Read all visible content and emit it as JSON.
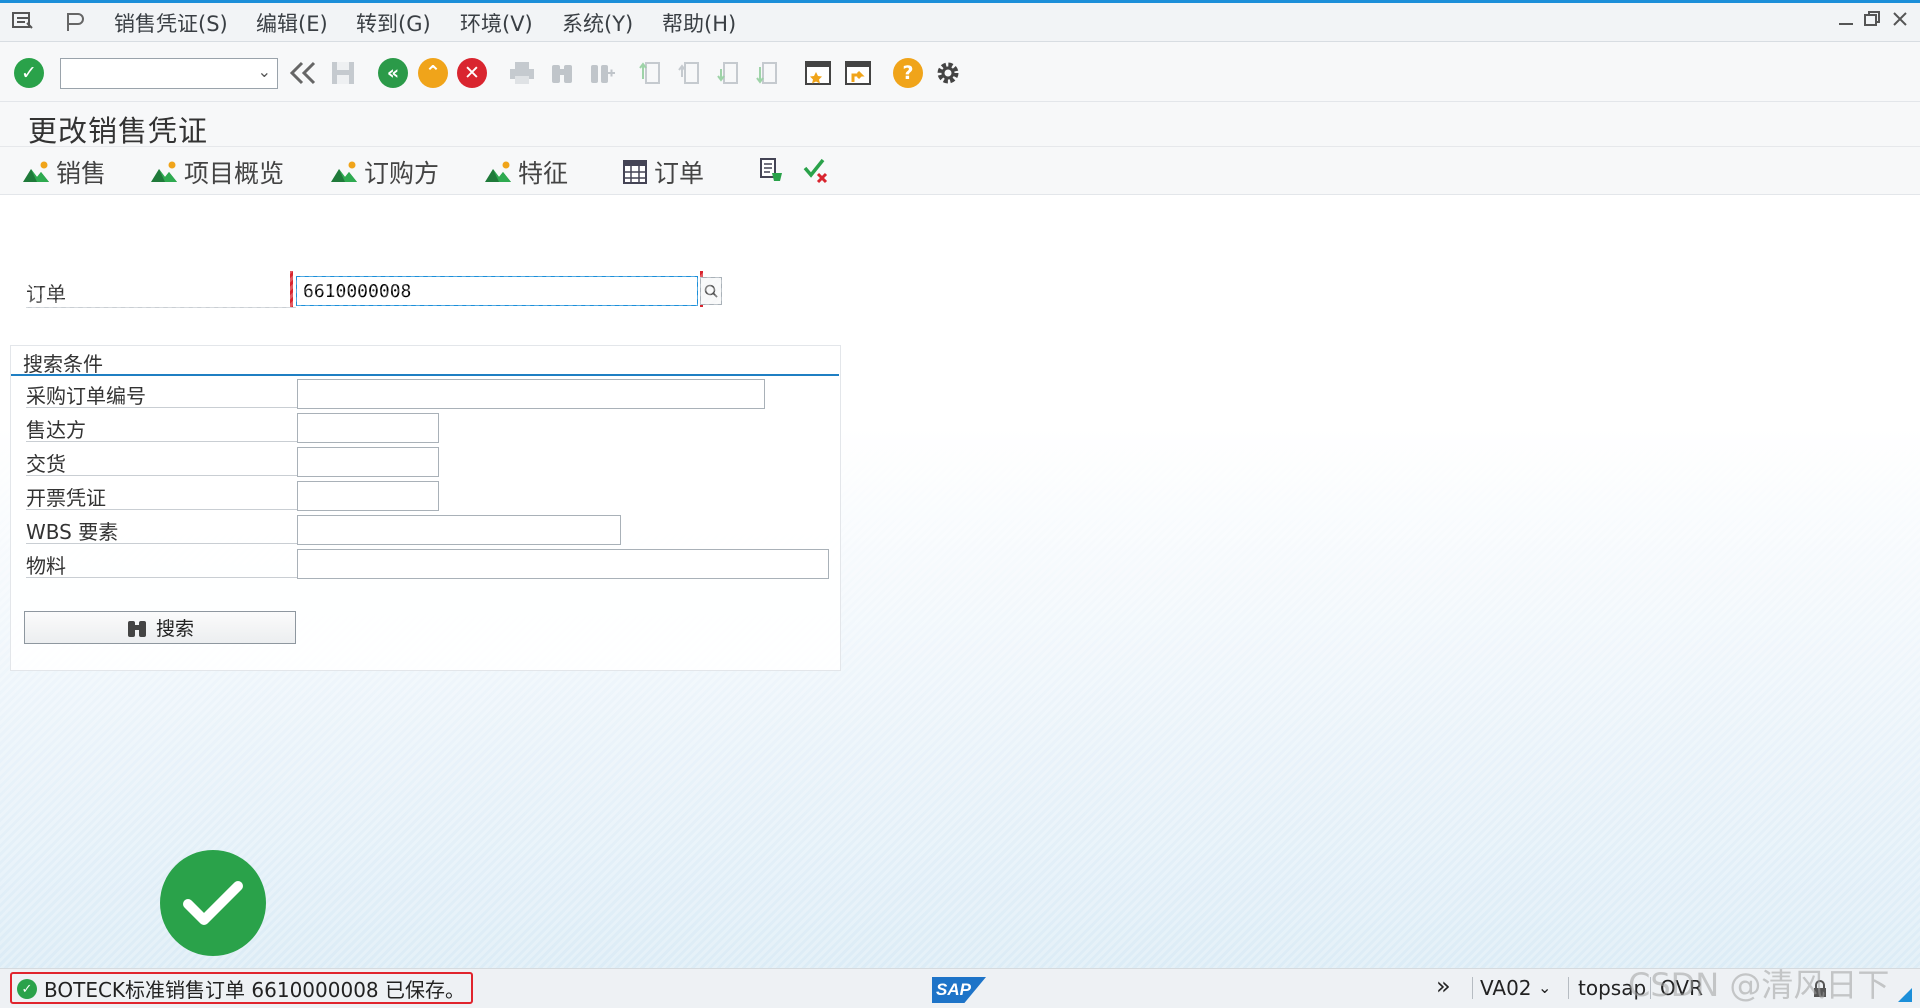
{
  "menu": {
    "items": [
      "销售凭证(S)",
      "编辑(E)",
      "转到(G)",
      "环境(V)",
      "系统(Y)",
      "帮助(H)"
    ]
  },
  "window_controls": [
    "minimize-icon",
    "restore-icon",
    "close-icon"
  ],
  "toolbar": {
    "command_field_value": "",
    "icons": [
      "enter-icon",
      "dropdown-icon",
      "back-double-icon",
      "save-icon",
      "back-icon",
      "exit-icon",
      "cancel-icon",
      "print-icon",
      "find-icon",
      "find-next-icon",
      "first-page-icon",
      "prev-page-icon",
      "next-page-icon",
      "last-page-icon",
      "new-session-icon",
      "shortcut-icon",
      "help-icon",
      "settings-icon"
    ]
  },
  "title": "更改销售凭证",
  "app_toolbar": {
    "sales": "销售",
    "item_overview": "项目概览",
    "ordering_party": "订购方",
    "characteristics": "特征",
    "order": "订单"
  },
  "form": {
    "order_label": "订单",
    "order_value": "6610000008",
    "search_group": {
      "header": "搜索条件",
      "fields": [
        {
          "label": "采购订单编号",
          "value": ""
        },
        {
          "label": "售达方",
          "value": ""
        },
        {
          "label": "交货",
          "value": ""
        },
        {
          "label": "开票凭证",
          "value": ""
        },
        {
          "label": "WBS 要素",
          "value": ""
        },
        {
          "label": "物料",
          "value": ""
        }
      ],
      "search_button": "搜索"
    }
  },
  "status": {
    "message": "BOTECK标准销售订单 6610000008 已保存。",
    "system_logo": "SAP",
    "transaction": "VA02",
    "server": "topsap",
    "mode": "OVR"
  },
  "watermark": "CSDN @清风日下",
  "colors": {
    "accent": "#1c8fd9",
    "success": "#2aa24a",
    "error_border": "#e0242d"
  }
}
